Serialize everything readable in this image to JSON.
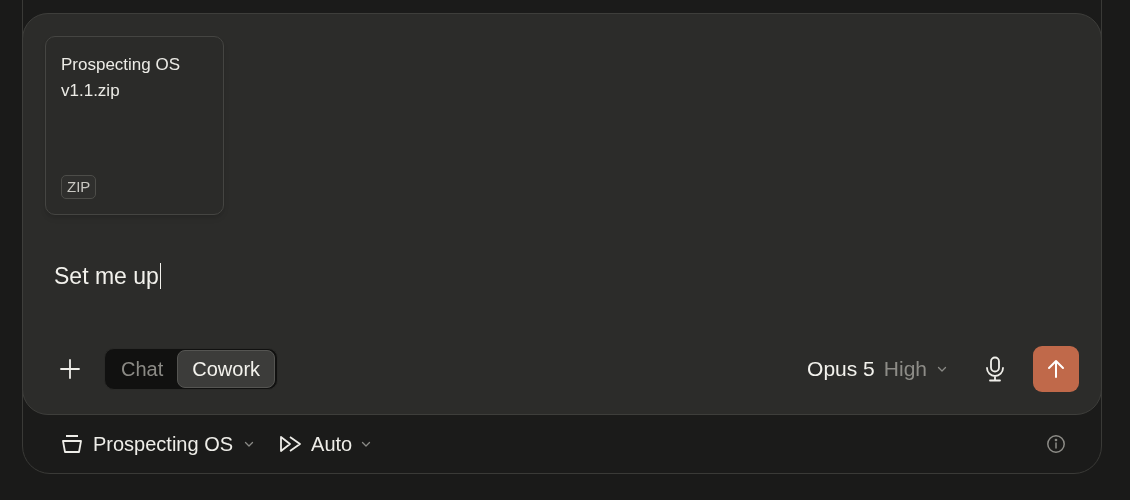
{
  "attachments": [
    {
      "name": "Prospecting OS v1.1.zip",
      "type_badge": "ZIP"
    }
  ],
  "message": {
    "value": "Set me up"
  },
  "mode_tabs": [
    {
      "label": "Chat",
      "selected": false
    },
    {
      "label": "Cowork",
      "selected": true
    }
  ],
  "model": {
    "name": "Opus 5",
    "effort": "High"
  },
  "footer": {
    "project": "Prospecting OS",
    "permission": "Auto"
  }
}
